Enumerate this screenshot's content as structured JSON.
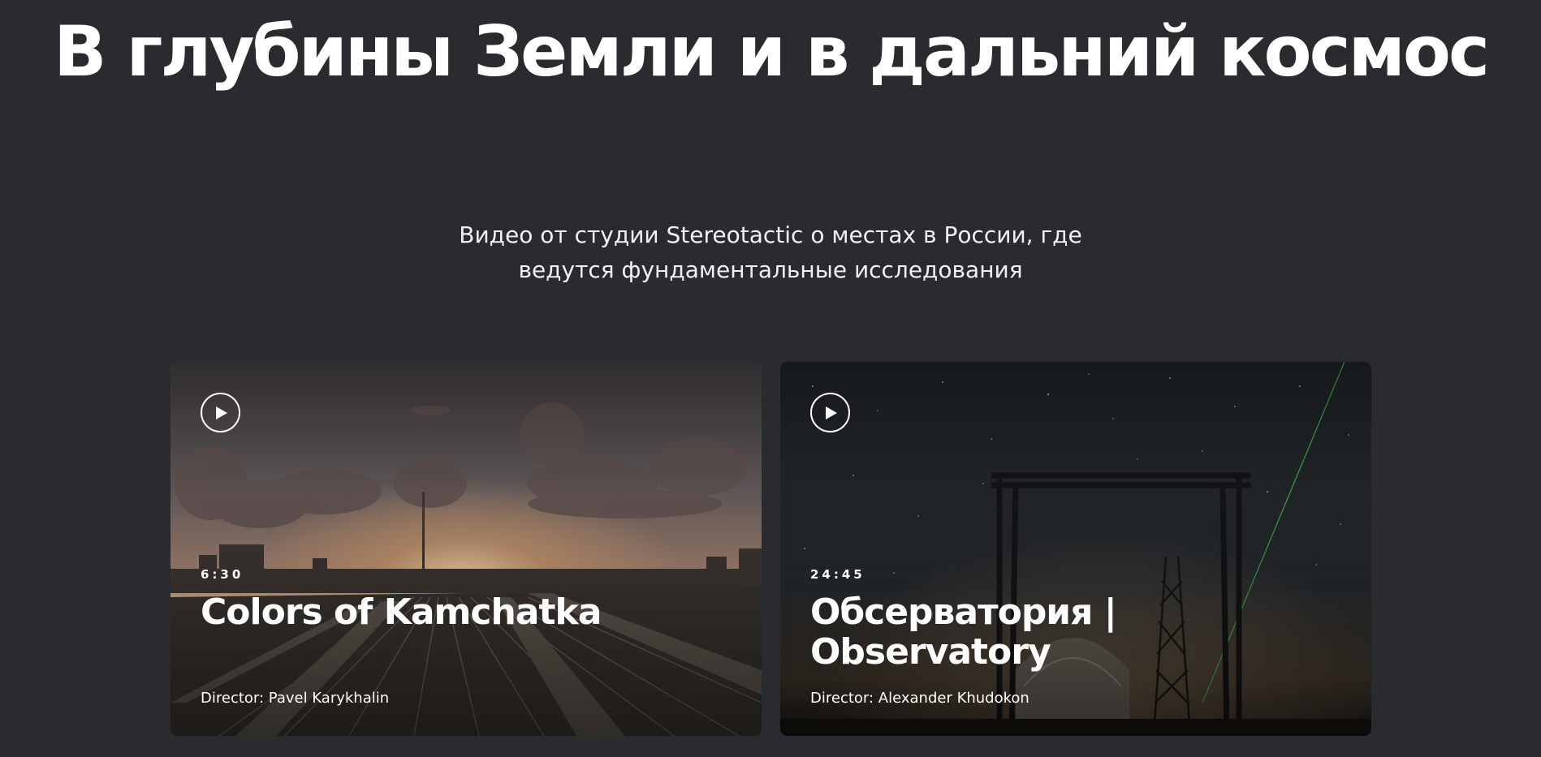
{
  "hero": {
    "title": "В глубины Земли и в дальний космос",
    "subtitle": "Видео от студии Stereotactic о местах в России, где ведутся фундаментальные исследования"
  },
  "videos": [
    {
      "duration": "6:30",
      "title": "Colors of Kamchatka",
      "director": "Director: Pavel Karykhalin",
      "icon": "play-icon"
    },
    {
      "duration": "24:45",
      "title": "Обсерватория | Observatory",
      "director": "Director: Alexander Khudokon",
      "icon": "play-icon"
    }
  ],
  "colors": {
    "background": "#2a2b2f",
    "text": "#ffffff"
  }
}
